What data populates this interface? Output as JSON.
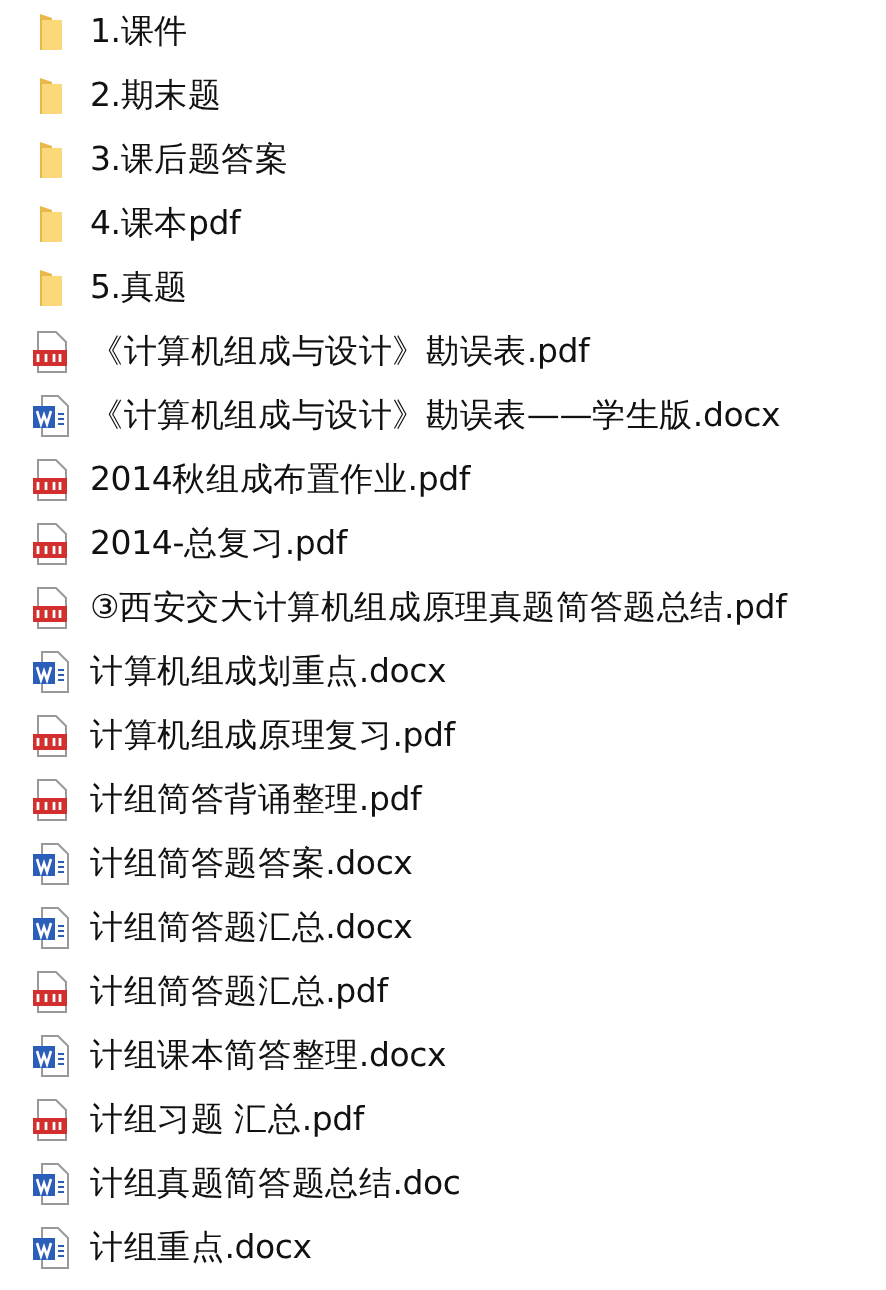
{
  "files": [
    {
      "kind": "folder",
      "name": "1.课件"
    },
    {
      "kind": "folder",
      "name": "2.期末题"
    },
    {
      "kind": "folder",
      "name": "3.课后题答案"
    },
    {
      "kind": "folder",
      "name": "4.课本pdf"
    },
    {
      "kind": "folder",
      "name": "5.真题"
    },
    {
      "kind": "pdf",
      "name": "《计算机组成与设计》勘误表.pdf"
    },
    {
      "kind": "word",
      "name": "《计算机组成与设计》勘误表——学生版.docx"
    },
    {
      "kind": "pdf",
      "name": "2014秋组成布置作业.pdf"
    },
    {
      "kind": "pdf",
      "name": "2014-总复习.pdf"
    },
    {
      "kind": "pdf",
      "name": "③西安交大计算机组成原理真题简答题总结.pdf"
    },
    {
      "kind": "word",
      "name": "计算机组成划重点.docx"
    },
    {
      "kind": "pdf",
      "name": "计算机组成原理复习.pdf"
    },
    {
      "kind": "pdf",
      "name": "计组简答背诵整理.pdf"
    },
    {
      "kind": "word",
      "name": "计组简答题答案.docx"
    },
    {
      "kind": "word",
      "name": "计组简答题汇总.docx"
    },
    {
      "kind": "pdf",
      "name": "计组简答题汇总.pdf"
    },
    {
      "kind": "word",
      "name": "计组课本简答整理.docx"
    },
    {
      "kind": "pdf",
      "name": "计组习题 汇总.pdf"
    },
    {
      "kind": "word",
      "name": "计组真题简答题总结.doc"
    },
    {
      "kind": "word",
      "name": "计组重点.docx"
    }
  ]
}
